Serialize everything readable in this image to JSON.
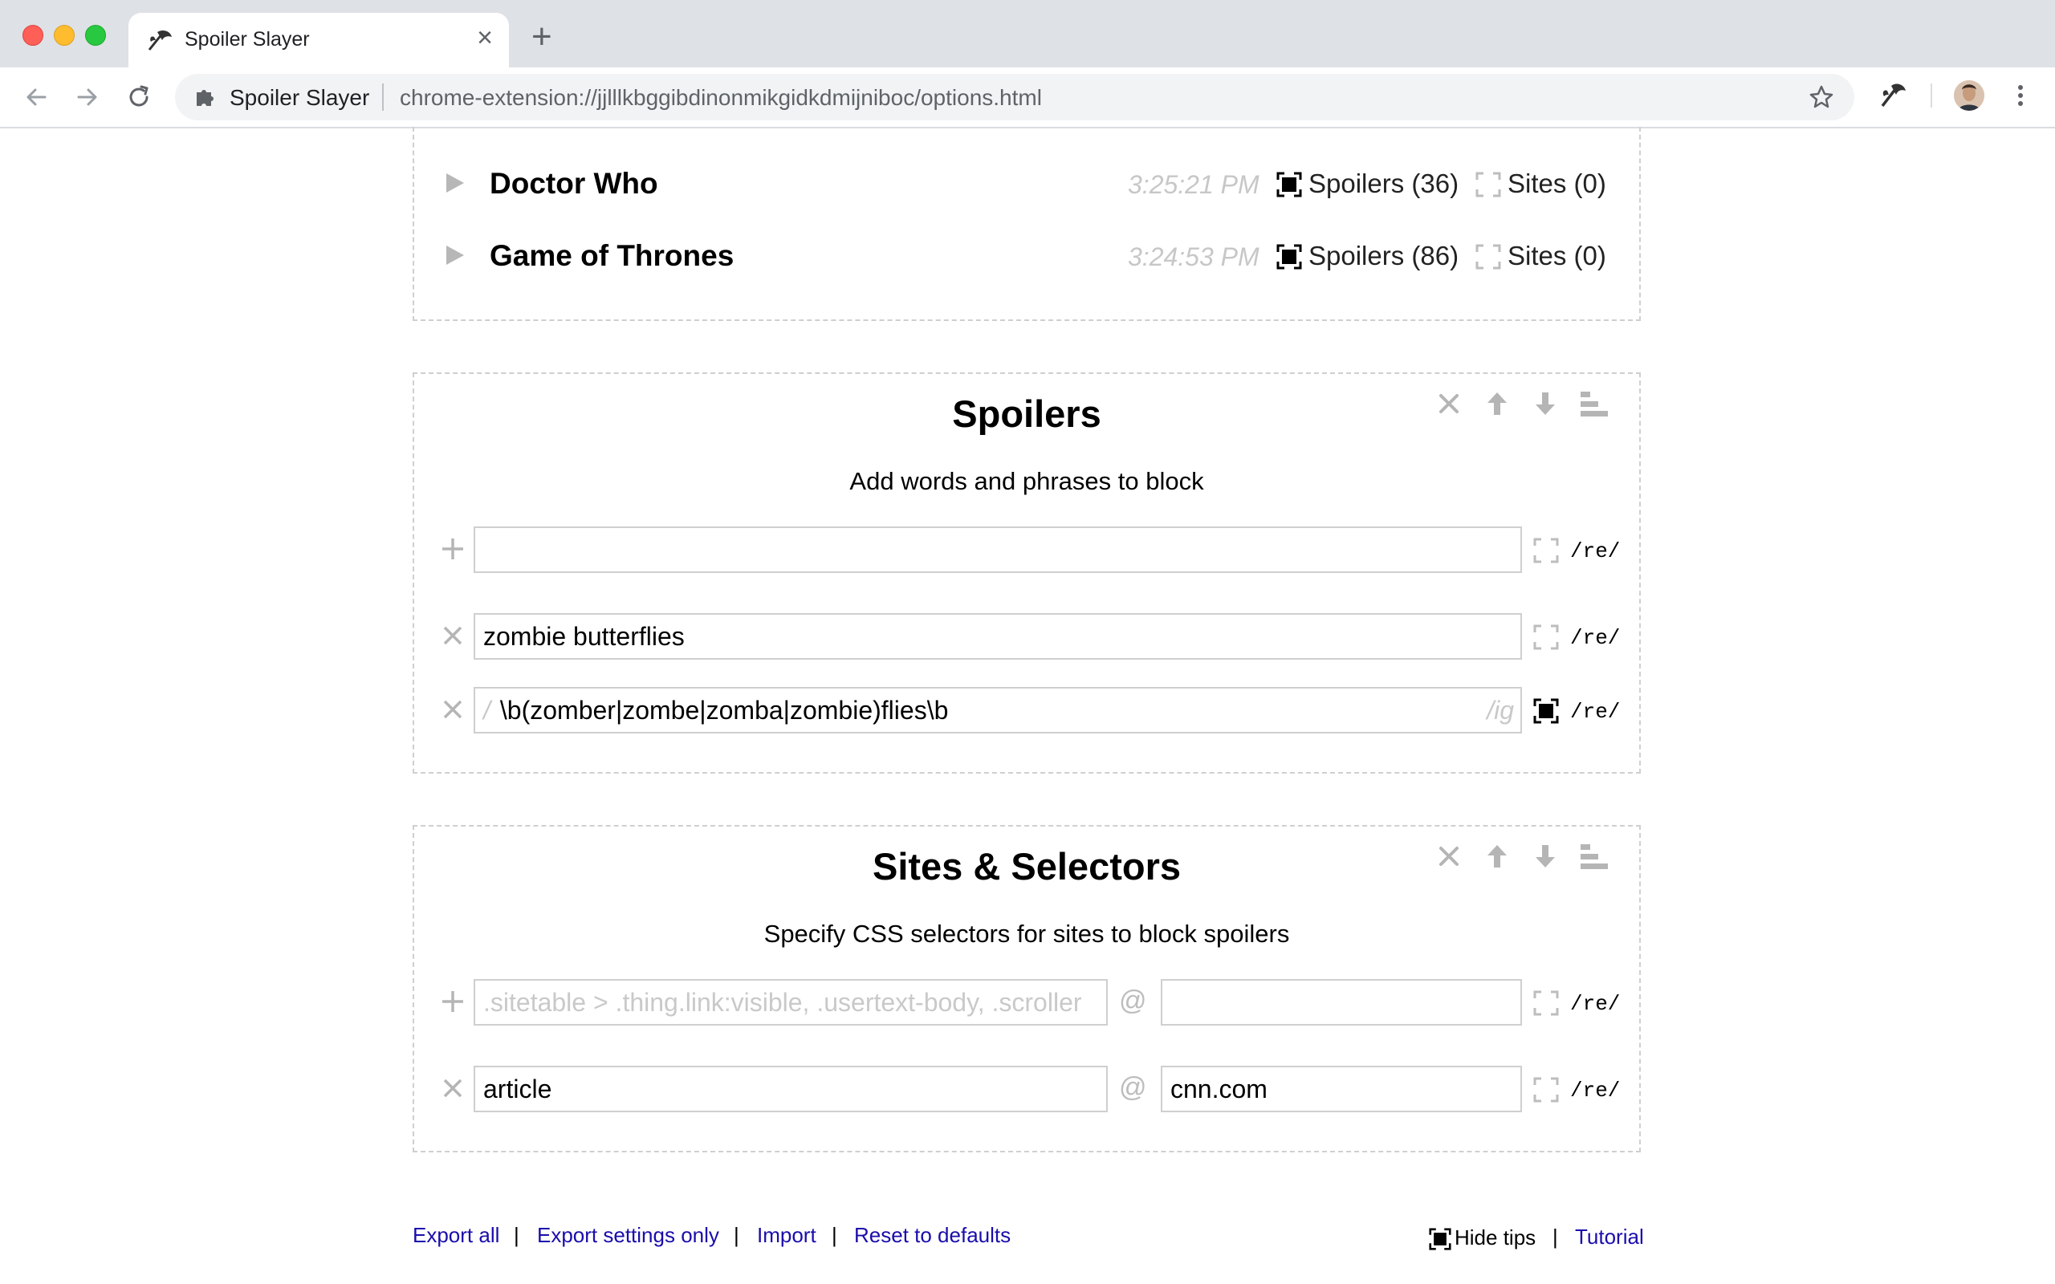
{
  "browser": {
    "tab_title": "Spoiler Slayer",
    "tab_close": "×",
    "new_tab": "+",
    "omnibox_name": "Spoiler Slayer",
    "url": "chrome-extension://jjlllkbggibdinonmikgidkdmijniboc/options.html"
  },
  "groups": [
    {
      "title": "Doctor Who",
      "time": "3:25:21 PM",
      "spoilers_label": "Spoilers (36)",
      "spoilers_checked": true,
      "sites_label": "Sites (0)",
      "sites_checked": false
    },
    {
      "title": "Game of Thrones",
      "time": "3:24:53 PM",
      "spoilers_label": "Spoilers (86)",
      "spoilers_checked": true,
      "sites_label": "Sites (0)",
      "sites_checked": false
    }
  ],
  "spoilers": {
    "title": "Spoilers",
    "subtitle": "Add words and phrases to block",
    "new_value": "",
    "entries": [
      {
        "value": "zombie butterflies",
        "is_regex": false
      },
      {
        "value": "\\b(zomber|zombe|zomba|zombie)flies\\b",
        "is_regex": true,
        "prefix": "/",
        "flags": "/ig"
      }
    ],
    "re_label": "/re/"
  },
  "sites": {
    "title": "Sites & Selectors",
    "subtitle": "Specify CSS selectors for sites to block spoilers",
    "selector_placeholder": ".sitetable > .thing.link:visible, .usertext-body, .scroller",
    "at": "@",
    "entries": [
      {
        "selector": "article",
        "site": "cnn.com",
        "is_regex": false
      }
    ],
    "re_label": "/re/"
  },
  "footer": {
    "export_all": "Export all",
    "export_settings": "Export settings only",
    "import": "Import",
    "reset": "Reset to defaults",
    "separator": "|",
    "hide_tips": "Hide tips",
    "tutorial": "Tutorial"
  },
  "colors": {
    "link": "#1a0dab",
    "border": "#cfcfcf",
    "muted": "#c7c7c7"
  }
}
